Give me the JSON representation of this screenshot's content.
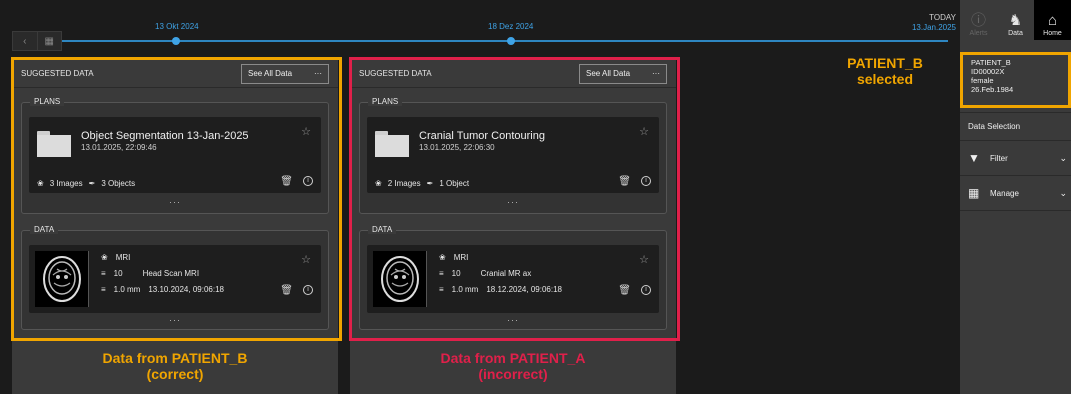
{
  "timeline": {
    "date_1": "13 Okt 2024",
    "date_2": "18 Dez 2024",
    "today_label": "TODAY",
    "today_date": "13.Jan.2025"
  },
  "columns": [
    {
      "header_title": "SUGGESTED DATA",
      "see_all_label": "See All Data",
      "plans_label": "PLANS",
      "plan": {
        "title": "Object Segmentation 13-Jan-2025",
        "datetime": "13.01.2025, 22:09:46",
        "images": "3 Images",
        "objects": "3 Objects"
      },
      "data_label": "DATA",
      "data_item": {
        "modality": "MRI",
        "count": "10",
        "description": "Head Scan MRI",
        "thickness": "1.0 mm",
        "datetime": "13.10.2024, 09:06:18"
      },
      "annotation_line1": "Data from PATIENT_B",
      "annotation_line2": "(correct)"
    },
    {
      "header_title": "SUGGESTED DATA",
      "see_all_label": "See All Data",
      "plans_label": "PLANS",
      "plan": {
        "title": "Cranial Tumor Contouring",
        "datetime": "13.01.2025, 22:06:30",
        "images": "2 Images",
        "objects": "1 Object"
      },
      "data_label": "DATA",
      "data_item": {
        "modality": "MRI",
        "count": "10",
        "description": "Cranial MR ax",
        "thickness": "1.0 mm",
        "datetime": "18.12.2024, 09:06:18"
      },
      "annotation_line1": "Data from PATIENT_A",
      "annotation_line2": "(incorrect)"
    }
  ],
  "selected_note": {
    "line1": "PATIENT_B",
    "line2": "selected"
  },
  "sidebar": {
    "alerts_label": "Alerts",
    "data_label": "Data",
    "home_label": "Home",
    "patient": {
      "name": "PATIENT_B",
      "id": "ID00002X",
      "sex": "female",
      "dob": "26.Feb.1984"
    },
    "section_label": "Data Selection",
    "filter_label": "Filter",
    "manage_label": "Manage"
  },
  "colors": {
    "accent_blue": "#3fa3e6",
    "highlight_correct": "#f0a500",
    "highlight_incorrect": "#e0204a"
  },
  "icons": [
    "back-icon",
    "calendar-icon",
    "star-icon",
    "image-icon",
    "object-icon",
    "trash-icon",
    "info-icon",
    "alerts-icon",
    "data-icon",
    "home-icon",
    "filter-icon",
    "manage-icon",
    "chevron-down-icon"
  ]
}
